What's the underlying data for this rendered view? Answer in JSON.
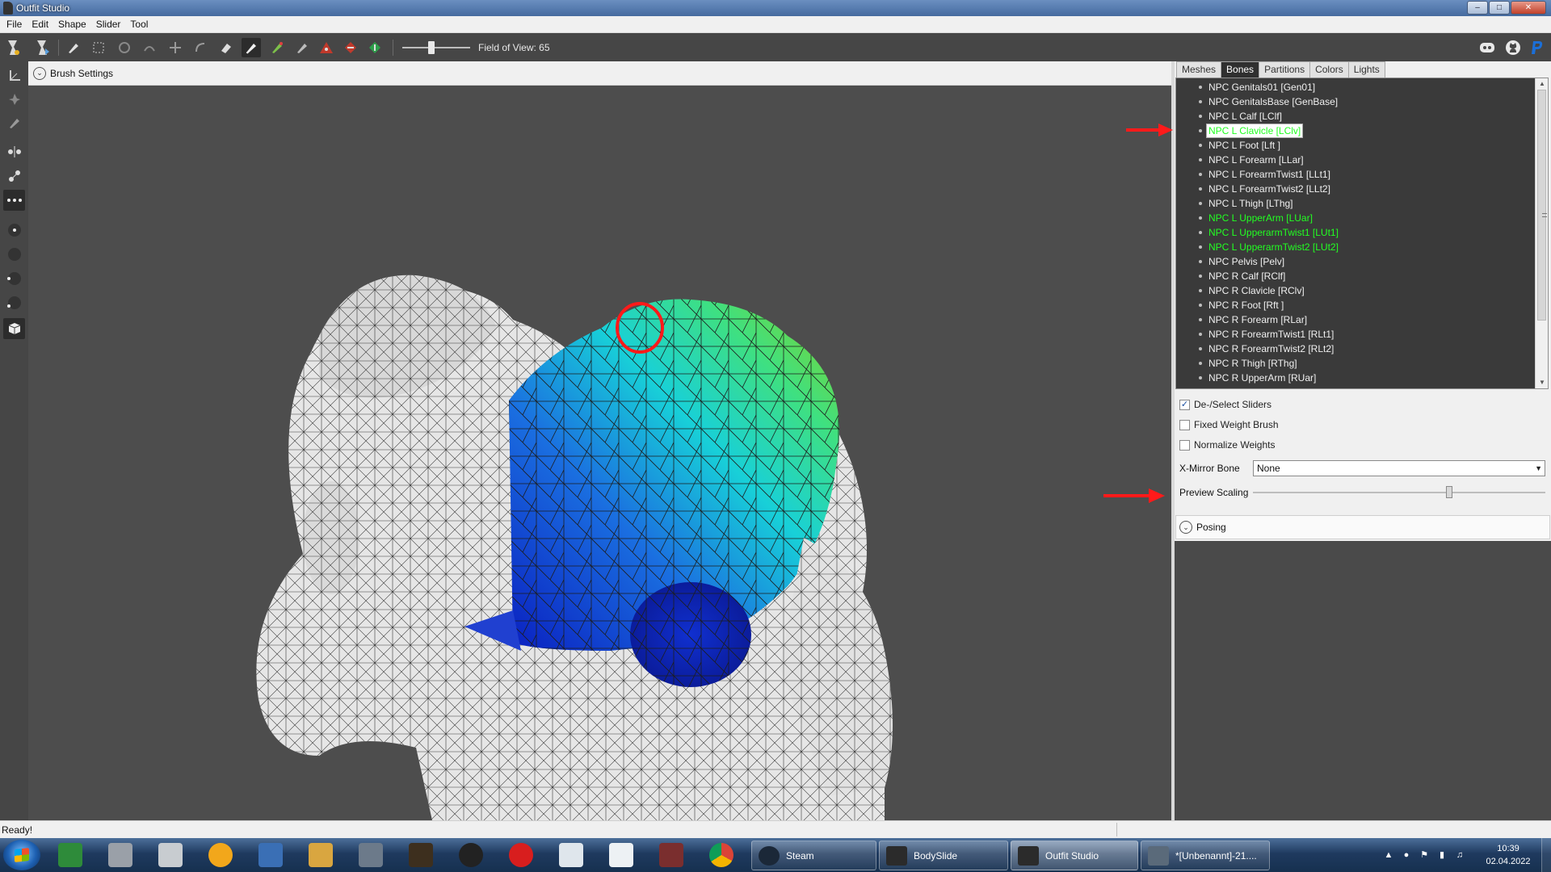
{
  "window": {
    "title": "Outfit Studio"
  },
  "menu": [
    "File",
    "Edit",
    "Shape",
    "Slider",
    "Tool"
  ],
  "toolbar": {
    "fov_label": "Field of View: 65",
    "left_icons": [
      "bodyslide-logo-icon",
      "export-icon",
      "select-brush-icon",
      "mask-brush-icon",
      "inflate-brush-icon",
      "deflate-brush-icon",
      "move-brush-icon",
      "smooth-brush-icon",
      "undiff-brush-icon",
      "weight-brush-icon",
      "color-brush-icon",
      "alpha-brush-icon",
      "collapse-vertex-icon",
      "flip-edge-icon",
      "split-edge-icon"
    ],
    "right_icons": [
      "discord-icon",
      "github-icon",
      "paypal-icon"
    ]
  },
  "left_tools": [
    "transform-tool-icon",
    "pivot-tool-icon",
    "vertex-edit-icon",
    "x-mirror-icon",
    "connected-only-icon",
    "global-brush-icon",
    "brush-size-1-icon",
    "brush-size-2-icon",
    "brush-size-3-icon",
    "brush-size-4-icon",
    "wireframe-toggle-icon"
  ],
  "viewport": {
    "brush_settings_label": "Brush Settings"
  },
  "panel": {
    "tabs": [
      "Meshes",
      "Bones",
      "Partitions",
      "Colors",
      "Lights"
    ],
    "active_tab": "Bones",
    "bones": [
      {
        "name": "NPC Genitals01 [Gen01]",
        "state": "normal"
      },
      {
        "name": "NPC GenitalsBase [GenBase]",
        "state": "normal"
      },
      {
        "name": "NPC L Calf [LClf]",
        "state": "normal"
      },
      {
        "name": "NPC L Clavicle [LClv]",
        "state": "selected"
      },
      {
        "name": "NPC L Foot [Lft ]",
        "state": "normal"
      },
      {
        "name": "NPC L Forearm [LLar]",
        "state": "normal"
      },
      {
        "name": "NPC L ForearmTwist1 [LLt1]",
        "state": "normal"
      },
      {
        "name": "NPC L ForearmTwist2 [LLt2]",
        "state": "normal"
      },
      {
        "name": "NPC L Thigh [LThg]",
        "state": "normal"
      },
      {
        "name": "NPC L UpperArm [LUar]",
        "state": "pose"
      },
      {
        "name": "NPC L UpperarmTwist1 [LUt1]",
        "state": "pose"
      },
      {
        "name": "NPC L UpperarmTwist2 [LUt2]",
        "state": "pose"
      },
      {
        "name": "NPC Pelvis [Pelv]",
        "state": "normal"
      },
      {
        "name": "NPC R Calf [RClf]",
        "state": "normal"
      },
      {
        "name": "NPC R Clavicle [RClv]",
        "state": "normal"
      },
      {
        "name": "NPC R Foot [Rft ]",
        "state": "normal"
      },
      {
        "name": "NPC R Forearm [RLar]",
        "state": "normal"
      },
      {
        "name": "NPC R ForearmTwist1 [RLt1]",
        "state": "normal"
      },
      {
        "name": "NPC R ForearmTwist2 [RLt2]",
        "state": "normal"
      },
      {
        "name": "NPC R Thigh [RThg]",
        "state": "normal"
      },
      {
        "name": "NPC R UpperArm [RUar]",
        "state": "normal"
      }
    ],
    "options": {
      "deselect_sliders": {
        "label": "De-/Select Sliders",
        "checked": true
      },
      "fixed_weight_brush": {
        "label": "Fixed Weight Brush",
        "checked": false
      },
      "normalize_weights": {
        "label": "Normalize Weights",
        "checked": false
      },
      "xmirror_label": "X-Mirror Bone",
      "xmirror_value": "None",
      "preview_scaling_label": "Preview Scaling",
      "preview_scaling_fraction": 0.66
    },
    "posing_label": "Posing"
  },
  "status": {
    "text": "Ready!"
  },
  "taskbar": {
    "pinned_icons": [
      "excel-icon",
      "media-center-icon",
      "explorer-icon",
      "itunes-icon",
      "pen-icon",
      "notepad-icon",
      "sword-icon",
      "game-icon",
      "black-circle-icon",
      "opera-icon",
      "window-icon",
      "window2-icon",
      "mx-icon",
      "chrome-icon"
    ],
    "tasks": [
      {
        "label": "Steam",
        "icon": "steam-icon"
      },
      {
        "label": "BodySlide",
        "icon": "bodyslide-icon"
      },
      {
        "label": "Outfit Studio",
        "icon": "outfit-studio-icon",
        "active": true
      },
      {
        "label": "*[Unbenannt]-21....",
        "icon": "image-editor-icon"
      }
    ],
    "clock_time": "10:39",
    "clock_date": "02.04.2022"
  },
  "colors": {
    "toolbar": "#464646",
    "viewport": "#4d4d4d",
    "bone_pose": "#22ff22",
    "annotation": "#ff1a1a"
  }
}
